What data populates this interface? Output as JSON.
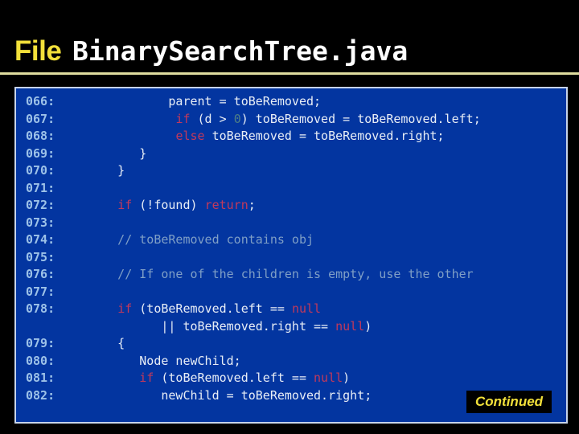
{
  "slide": {
    "title": {
      "label": "File",
      "filename": "BinarySearchTree.java"
    },
    "colors": {
      "background": "#000000",
      "panel_background": "#0335a0",
      "panel_border": "#c7d4ea",
      "rule": "#e0dda0",
      "title_label": "#f2e03a",
      "title_filename": "#ffffff",
      "line_number": "#9dc2e8",
      "code_text": "#e8eef6",
      "keyword": "#c2395b",
      "comment": "#7f9fc6",
      "number_literal": "#4f7f86",
      "badge_text": "#f2e03a",
      "badge_background": "#000000"
    },
    "badge": {
      "label": "Continued"
    },
    "code": {
      "lines": [
        {
          "number": "066:",
          "tokens": [
            {
              "t": "             parent = toBeRemoved;",
              "c": "pl"
            }
          ]
        },
        {
          "number": "067:",
          "tokens": [
            {
              "t": "              ",
              "c": "pl"
            },
            {
              "t": "if",
              "c": "kw"
            },
            {
              "t": " (d > ",
              "c": "pl"
            },
            {
              "t": "0",
              "c": "num"
            },
            {
              "t": ") toBeRemoved = toBeRemoved.left;",
              "c": "pl"
            }
          ]
        },
        {
          "number": "068:",
          "tokens": [
            {
              "t": "              ",
              "c": "pl"
            },
            {
              "t": "else",
              "c": "kw"
            },
            {
              "t": " toBeRemoved = toBeRemoved.right;",
              "c": "pl"
            }
          ]
        },
        {
          "number": "069:",
          "tokens": [
            {
              "t": "         }",
              "c": "pl"
            }
          ]
        },
        {
          "number": "070:",
          "tokens": [
            {
              "t": "      }",
              "c": "pl"
            }
          ]
        },
        {
          "number": "071:",
          "tokens": [
            {
              "t": "",
              "c": "pl"
            }
          ]
        },
        {
          "number": "072:",
          "tokens": [
            {
              "t": "      ",
              "c": "pl"
            },
            {
              "t": "if",
              "c": "kw"
            },
            {
              "t": " (!found) ",
              "c": "pl"
            },
            {
              "t": "return",
              "c": "kw"
            },
            {
              "t": ";",
              "c": "pl"
            }
          ]
        },
        {
          "number": "073:",
          "tokens": [
            {
              "t": "",
              "c": "pl"
            }
          ]
        },
        {
          "number": "074:",
          "tokens": [
            {
              "t": "      // toBeRemoved contains obj",
              "c": "cm"
            }
          ]
        },
        {
          "number": "075:",
          "tokens": [
            {
              "t": "",
              "c": "pl"
            }
          ]
        },
        {
          "number": "076:",
          "tokens": [
            {
              "t": "      // If one of the children is empty, use the other",
              "c": "cm"
            }
          ]
        },
        {
          "number": "077:",
          "tokens": [
            {
              "t": "",
              "c": "pl"
            }
          ]
        },
        {
          "number": "078:",
          "tokens": [
            {
              "t": "      ",
              "c": "pl"
            },
            {
              "t": "if",
              "c": "kw"
            },
            {
              "t": " (toBeRemoved.left == ",
              "c": "pl"
            },
            {
              "t": "null",
              "c": "kw"
            }
          ]
        },
        {
          "number": "",
          "tokens": [
            {
              "t": "            || toBeRemoved.right == ",
              "c": "pl"
            },
            {
              "t": "null",
              "c": "kw"
            },
            {
              "t": ")",
              "c": "pl"
            }
          ]
        },
        {
          "number": "079:",
          "tokens": [
            {
              "t": "      {",
              "c": "pl"
            }
          ]
        },
        {
          "number": "080:",
          "tokens": [
            {
              "t": "         Node newChild;",
              "c": "pl"
            }
          ]
        },
        {
          "number": "081:",
          "tokens": [
            {
              "t": "         ",
              "c": "pl"
            },
            {
              "t": "if",
              "c": "kw"
            },
            {
              "t": " (toBeRemoved.left == ",
              "c": "pl"
            },
            {
              "t": "null",
              "c": "kw"
            },
            {
              "t": ")",
              "c": "pl"
            }
          ]
        },
        {
          "number": "082:",
          "tokens": [
            {
              "t": "            newChild = toBeRemoved.right;",
              "c": "pl"
            }
          ]
        }
      ]
    }
  }
}
